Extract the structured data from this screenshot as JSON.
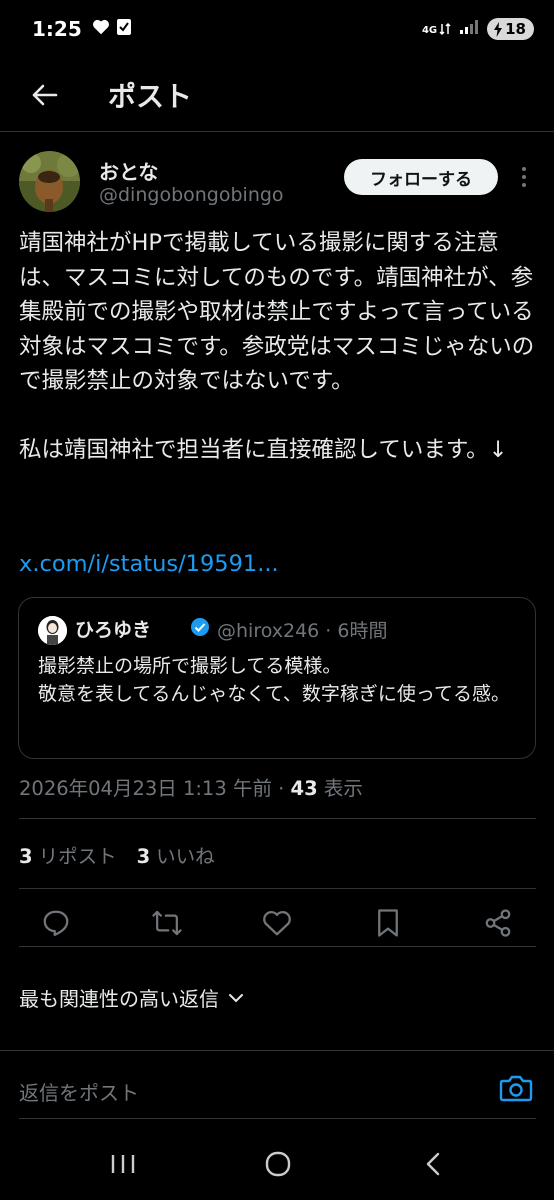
{
  "status": {
    "time": "1:25",
    "network": "4G",
    "battery": "18"
  },
  "header": {
    "title": "ポスト"
  },
  "author": {
    "name": "おとな",
    "handle": "@dingobongobingo",
    "follow_label": "フォローする"
  },
  "post": {
    "paragraphs": [
      "靖国神社がHPで掲載している撮影に関する注意は、マスコミに対してのものです。靖国神社が、参集殿前での撮影や取材は禁止ですよって言っている対象はマスコミです。参政党はマスコミじゃないので撮影禁止の対象ではないです。",
      "私は靖国神社で担当者に直接確認しています。↓"
    ],
    "link": "x.com/i/status/19591..."
  },
  "quote": {
    "name": "ひろゆき",
    "handle_time": "@hirox246 · 6時間",
    "text_lines": [
      "撮影禁止の場所で撮影してる模様。",
      "敬意を表してるんじゃなくて、数字稼ぎに使ってる感。"
    ]
  },
  "meta": {
    "datetime": "2026年04月23日 1:13 午前 · ",
    "views_count": "43",
    "views_label": " 表示"
  },
  "stats": {
    "reposts_count": "3",
    "reposts_label": "リポスト",
    "likes_count": "3",
    "likes_label": "いいね"
  },
  "actions": [
    "reply-icon",
    "repost-icon",
    "like-icon",
    "bookmark-icon",
    "share-icon"
  ],
  "sort": {
    "label": "最も関連性の高い返信"
  },
  "reply": {
    "placeholder": "返信をポスト"
  },
  "colors": {
    "background": "#000000",
    "text": "#e7e9ea",
    "muted": "#71767b",
    "link": "#1d9bf0",
    "border": "#2f3336"
  }
}
